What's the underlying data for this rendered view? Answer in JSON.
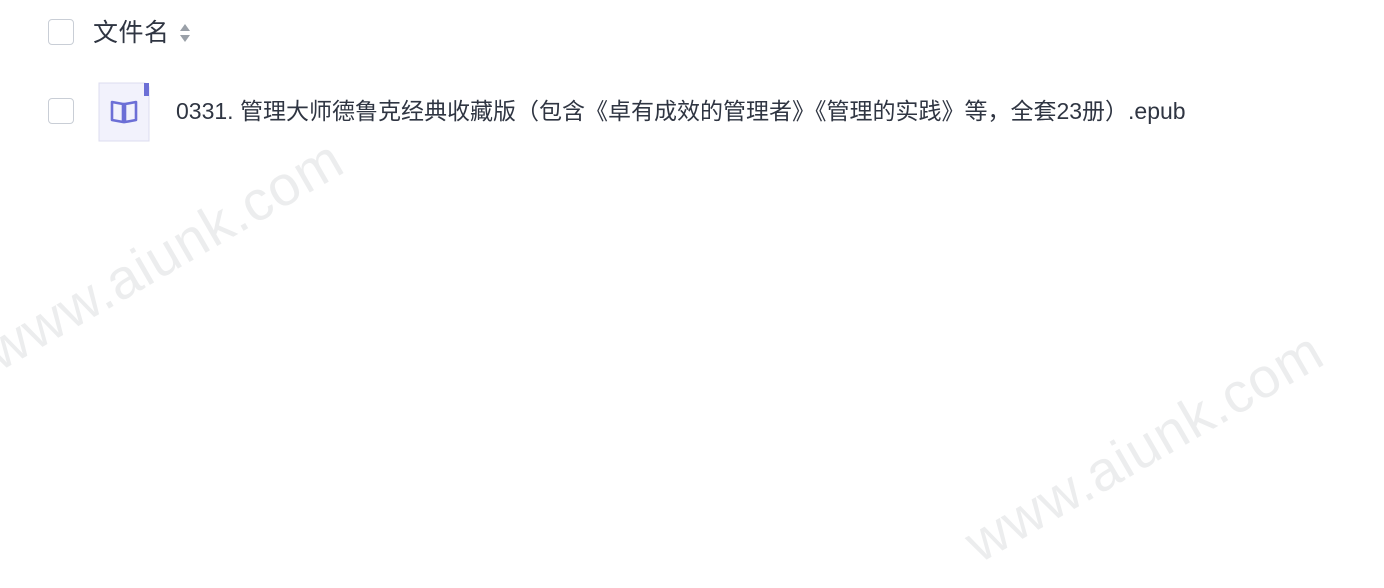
{
  "header": {
    "column_title": "文件名"
  },
  "files": [
    {
      "name": "0331. 管理大师德鲁克经典收藏版（包含《卓有成效的管理者》《管理的实践》等，全套23册）.epub",
      "icon": "ebook-file-icon"
    }
  ],
  "watermark": "www.aiunk.com",
  "colors": {
    "text": "#2f3542",
    "checkbox_border": "#c9ced6",
    "icon_accent": "#6c6fd6",
    "icon_bg": "#f2f2fc"
  }
}
